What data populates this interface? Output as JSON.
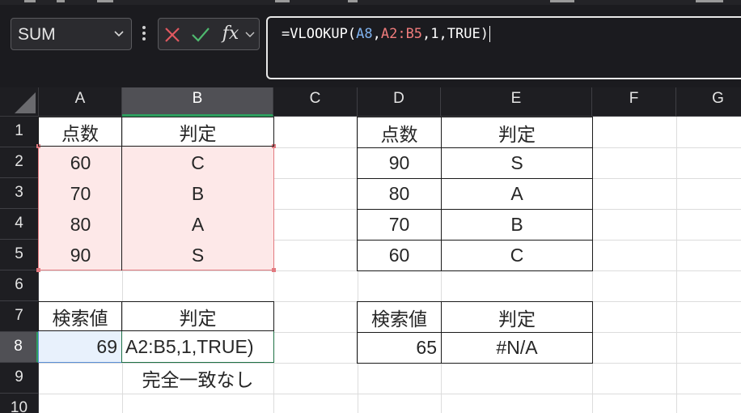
{
  "name_box": {
    "value": "SUM"
  },
  "formula_bar": {
    "fx_label": "fx",
    "formula": {
      "prefix": "=VLOOKUP(",
      "ref_lookup": "A8",
      "sep1": ",",
      "ref_range": "A2:B5",
      "suffix": ",1,TRUE)"
    }
  },
  "columns": [
    "A",
    "B",
    "C",
    "D",
    "E",
    "F",
    "G"
  ],
  "rows": [
    "1",
    "2",
    "3",
    "4",
    "5",
    "6",
    "7",
    "8",
    "9",
    "10"
  ],
  "sheet": {
    "left_table": {
      "header": [
        "点数",
        "判定"
      ],
      "rows": [
        [
          "60",
          "C"
        ],
        [
          "70",
          "B"
        ],
        [
          "80",
          "A"
        ],
        [
          "90",
          "S"
        ]
      ]
    },
    "right_table": {
      "header": [
        "点数",
        "判定"
      ],
      "rows": [
        [
          "90",
          "S"
        ],
        [
          "80",
          "A"
        ],
        [
          "70",
          "B"
        ],
        [
          "60",
          "C"
        ]
      ]
    },
    "left_lookup": {
      "header": [
        "検索値",
        "判定"
      ],
      "value": "69",
      "result_editing": "A2:B5,1,TRUE)",
      "note": "完全一致なし"
    },
    "right_lookup": {
      "header": [
        "検索値",
        "判定"
      ],
      "value": "65",
      "result": "#N/A"
    }
  },
  "colors": {
    "ribbon_bg": "#1b1b1f",
    "cancel_icon": "#e0585f",
    "enter_icon": "#4fb96f",
    "lookup_ref": "#7fb2ee",
    "range_ref": "#f07c7c",
    "range_fill": "#fde8e8",
    "lookup_fill": "#e8f1fc",
    "active_cell_border": "#1e7145"
  }
}
